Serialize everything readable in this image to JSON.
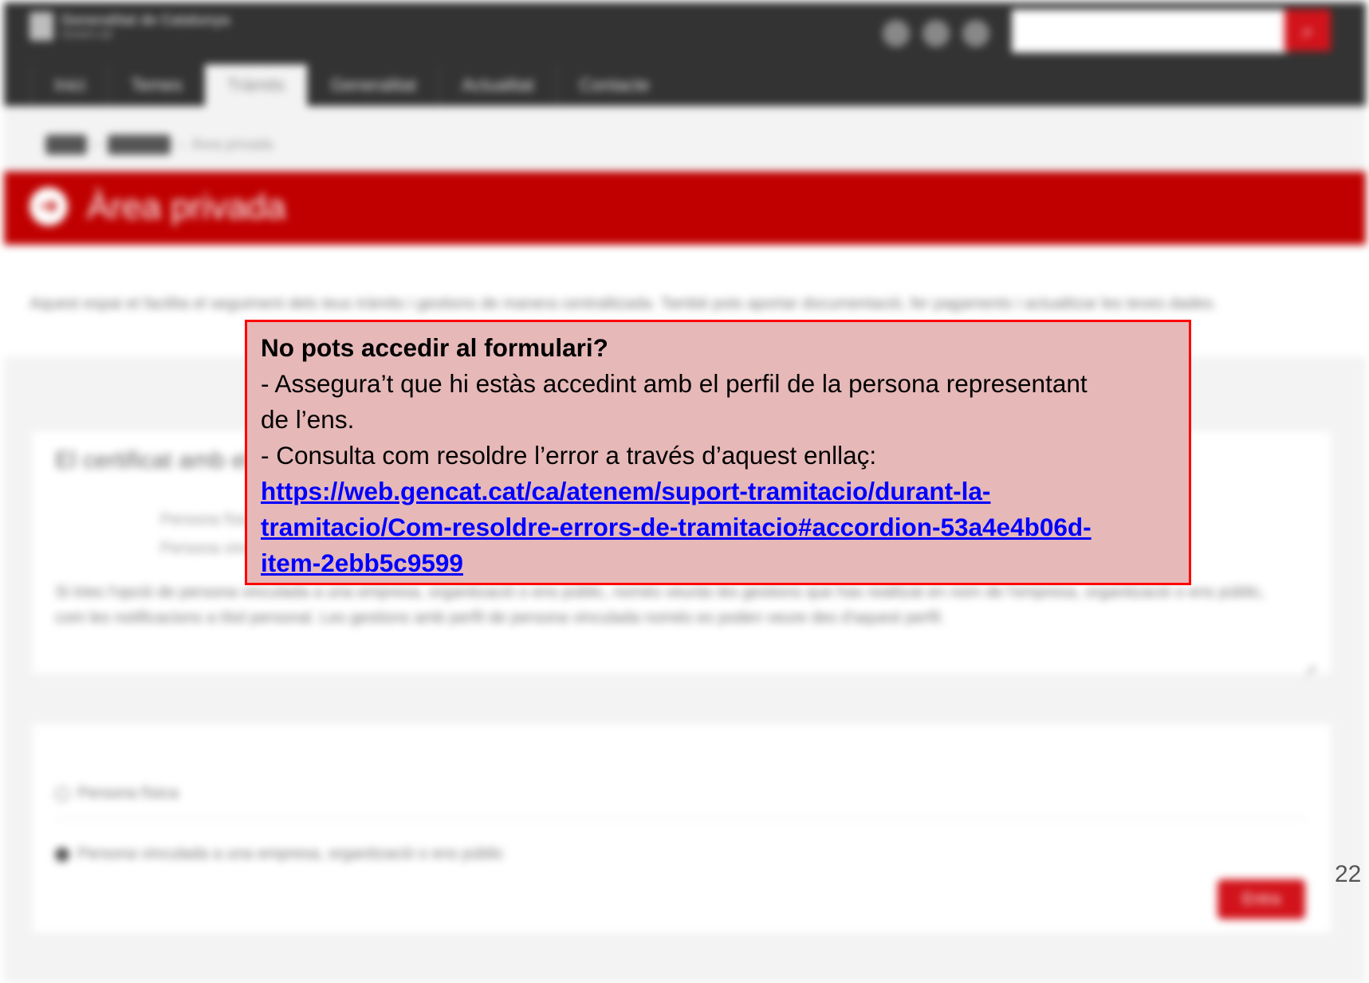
{
  "header": {
    "logo_title": "Generalitat de Catalunya",
    "logo_subtitle": "Govern.cat",
    "nav_tabs": [
      "Inici",
      "Temes",
      "Tràmits",
      "Generalitat",
      "Actualitat",
      "Contacte"
    ],
    "active_tab": "Tràmits",
    "search_icon": "search-icon"
  },
  "breadcrumb": {
    "items": [
      "Inici",
      "Tràmits",
      "Àrea privada"
    ]
  },
  "banner": {
    "title": "Àrea privada",
    "icon": "arrow-circle-icon"
  },
  "intro": {
    "text": "Aquest espai et facilita el seguiment dels teus tràmits i gestions de manera centralitzada. També pots aportar documentació, fer pagaments i actualitzar les teves dades."
  },
  "card1": {
    "title": "El certificat amb el qual has accedit",
    "items": [
      "Persona física",
      "Persona vinculada a una empresa"
    ],
    "paragraph": "Si tries l'opció de persona vinculada a una empresa, organització o ens públic, només veuràs les gestions que has realitzat en nom de l'empresa, organització o ens públic, com les notificacions a títol personal. Les gestions amb perfil de persona vinculada només es poden veure des d'aquest perfil.",
    "corner_label": "↗"
  },
  "card2": {
    "options": [
      "Persona física",
      "Persona vinculada a una empresa, organització o ens públic"
    ],
    "selected": 1,
    "button_label": "Entra"
  },
  "popup": {
    "title": "No pots accedir al formulari?",
    "line1a": "- Assegura’t que hi estàs accedint amb el perfil de la persona representant",
    "line1b": "de l’ens.",
    "line2": "- Consulta com resoldre l’error a través d’aquest enllaç:",
    "link_lines": [
      "https://web.gencat.cat/ca/atenem/suport-tramitacio/durant-la-",
      "tramitacio/Com-resoldre-errors-de-tramitacio#accordion-53a4e4b06d-",
      "item-2ebb5c9599"
    ],
    "border_color": "#ff0000",
    "background_color": "#e6b8b8",
    "link_color": "#0000ff"
  },
  "page_number": "22"
}
